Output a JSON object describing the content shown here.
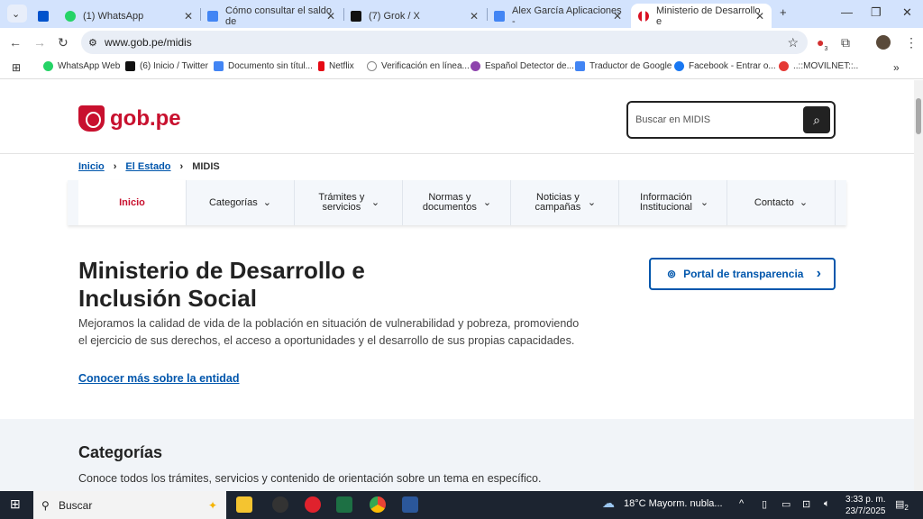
{
  "browser": {
    "tabs": [
      {
        "title": "(1) WhatsApp",
        "color": "#25d366"
      },
      {
        "title": "Cómo consultar el saldo de",
        "color": "#4285f4"
      },
      {
        "title": "(7) Grok / X",
        "color": "#111111"
      },
      {
        "title": "Alex García Aplicaciones -",
        "color": "#4285f4"
      },
      {
        "title": "Ministerio de Desarrollo e",
        "color": "#d91023"
      }
    ],
    "url": "www.gob.pe/midis",
    "extension_badge": "3",
    "bookmarks": [
      {
        "label": "WhatsApp Web",
        "color": "#25d366"
      },
      {
        "label": "(6) Inicio / Twitter",
        "color": "#111111"
      },
      {
        "label": "Documento sin títul...",
        "color": "#4285f4"
      },
      {
        "label": "Netflix",
        "color": "#e50914"
      },
      {
        "label": "Verificación en línea...",
        "color": "#888888"
      },
      {
        "label": "Español Detector de...",
        "color": "#8e44ad"
      },
      {
        "label": "Traductor de Google",
        "color": "#4285f4"
      },
      {
        "label": "Facebook - Entrar o...",
        "color": "#1877f2"
      },
      {
        "label": "..::MOVILNET::..",
        "color": "#e53935"
      }
    ]
  },
  "site": {
    "logo": "gob.pe",
    "search_placeholder": "Buscar en MIDIS",
    "breadcrumb": [
      "Inicio",
      "El Estado",
      "MIDIS"
    ],
    "nav": [
      "Inicio",
      "Categorías",
      "Trámites y servicios",
      "Normas y documentos",
      "Noticias y campañas",
      "Información Institucional",
      "Contacto"
    ],
    "title": "Ministerio de Desarrollo e Inclusión Social",
    "description": "Mejoramos la calidad de vida de la población en situación de vulnerabilidad y pobreza, promoviendo el ejercicio de sus derechos, el acceso a oportunidades y el desarrollo de sus propias capacidades.",
    "more_link": "Conocer más sobre la entidad",
    "portal_button": "Portal de transparencia",
    "categories_title": "Categorías",
    "categories_desc": "Conoce todos los trámites, servicios y contenido de orientación sobre un tema en específico."
  },
  "taskbar": {
    "search": "Buscar",
    "weather": "18°C  Mayorm. nubla...",
    "time": "3:33 p. m.",
    "date": "23/7/2025",
    "notifications": "2"
  }
}
